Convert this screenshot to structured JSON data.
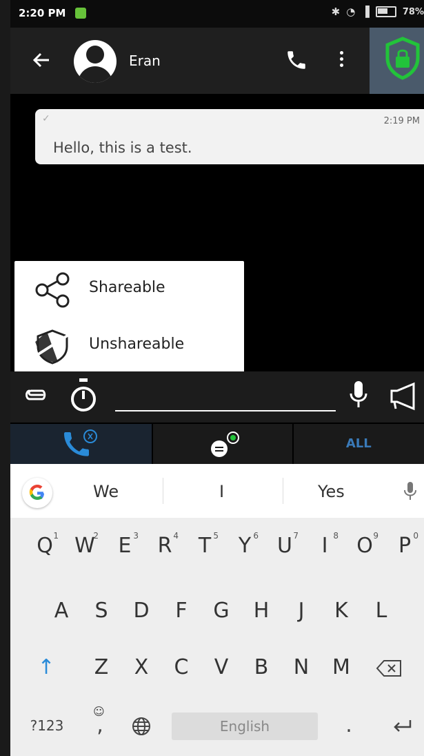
{
  "status_bar": {
    "time": "2:20 PM",
    "battery": "78%"
  },
  "header": {
    "contact_name": "Eran"
  },
  "message": {
    "text": "Hello, this is a test.",
    "time": "2:19 PM"
  },
  "share_menu": {
    "items": [
      {
        "label": "Shareable"
      },
      {
        "label": "Unshareable"
      }
    ]
  },
  "tabs": {
    "all_label": "ALL"
  },
  "keyboard": {
    "suggestions": [
      "We",
      "I",
      "Yes"
    ],
    "row1": [
      {
        "key": "Q",
        "hint": "1"
      },
      {
        "key": "W",
        "hint": "2"
      },
      {
        "key": "E",
        "hint": "3"
      },
      {
        "key": "R",
        "hint": "4"
      },
      {
        "key": "T",
        "hint": "5"
      },
      {
        "key": "Y",
        "hint": "6"
      },
      {
        "key": "U",
        "hint": "7"
      },
      {
        "key": "I",
        "hint": "8"
      },
      {
        "key": "O",
        "hint": "9"
      },
      {
        "key": "P",
        "hint": "0"
      }
    ],
    "row2": [
      "A",
      "S",
      "D",
      "F",
      "G",
      "H",
      "J",
      "K",
      "L"
    ],
    "row3": [
      "Z",
      "X",
      "C",
      "V",
      "B",
      "N",
      "M"
    ],
    "symbols_label": "?123",
    "comma_label": ",",
    "space_label": "English",
    "period_label": "."
  },
  "colors": {
    "accent": "#2a8bd8",
    "shield": "#22c33a",
    "shield_bg": "#4a5a6b"
  }
}
